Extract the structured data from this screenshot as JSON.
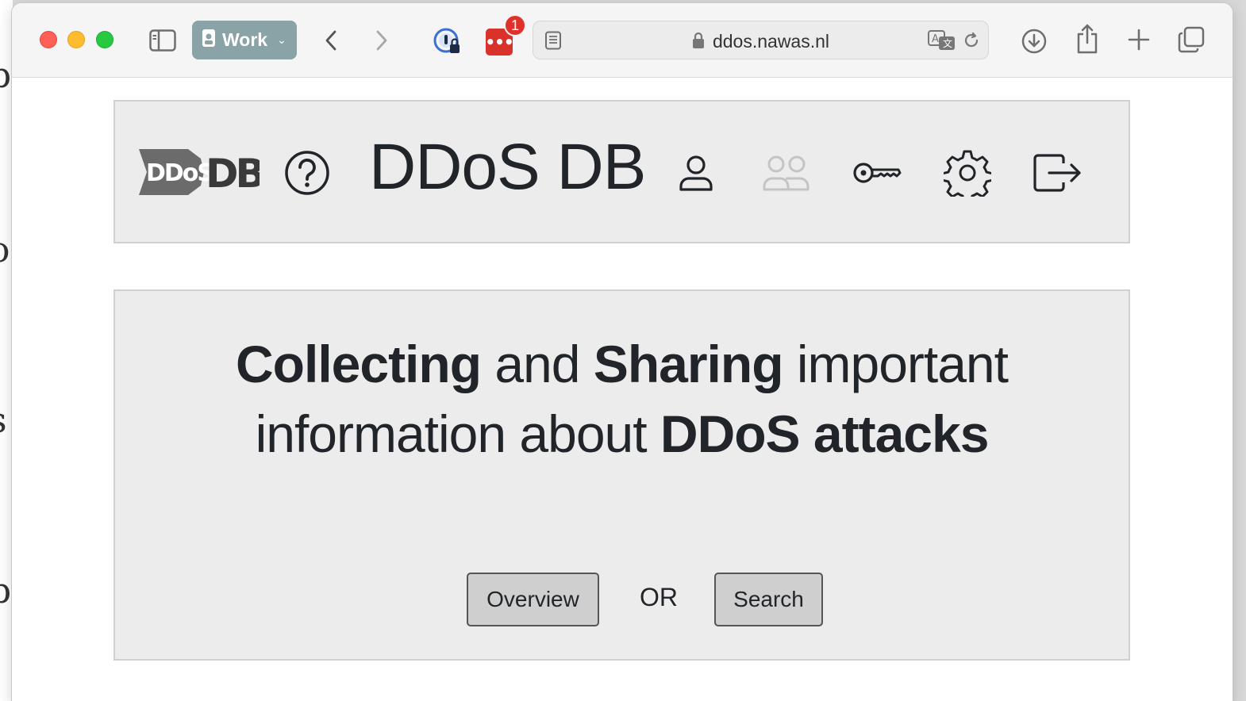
{
  "browser": {
    "profile_label": "Work",
    "extension_badge_count": "1",
    "url": "ddos.nawas.nl"
  },
  "site": {
    "logo_text_left": "DDoS",
    "logo_text_right": "DB",
    "title": "DDoS DB"
  },
  "hero": {
    "line1_a": "Collecting",
    "line1_b": " and ",
    "line1_c": "Sharing",
    "line1_d": " important",
    "line2_a": "information about ",
    "line2_b": "DDoS attacks",
    "overview_label": "Overview",
    "or_label": "OR",
    "search_label": "Search"
  },
  "colors": {
    "header_bg": "#ececec",
    "profile_pill": "#8aa3a6",
    "extension_red": "#d9322a"
  }
}
